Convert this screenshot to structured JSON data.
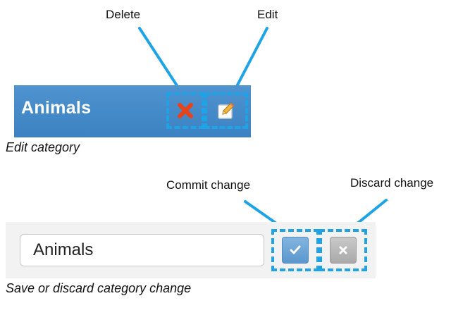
{
  "callouts": {
    "delete": "Delete",
    "edit": "Edit",
    "commit": "Commit change",
    "discard": "Discard change"
  },
  "edit_category": {
    "category_label": "Animals",
    "caption": "Edit category",
    "delete_icon": "close-x-icon",
    "edit_icon": "pencil-edit-icon"
  },
  "save_discard": {
    "input_value": "Animals",
    "caption": "Save or discard category change",
    "commit_icon": "checkmark-icon",
    "discard_icon": "close-x-icon"
  },
  "colors": {
    "highlight": "#1ea4e6",
    "category_bar": "#4a8ccb",
    "commit_button": "#6ea6d8",
    "discard_button": "#b8b8b8",
    "delete_icon": "#e8431a"
  }
}
